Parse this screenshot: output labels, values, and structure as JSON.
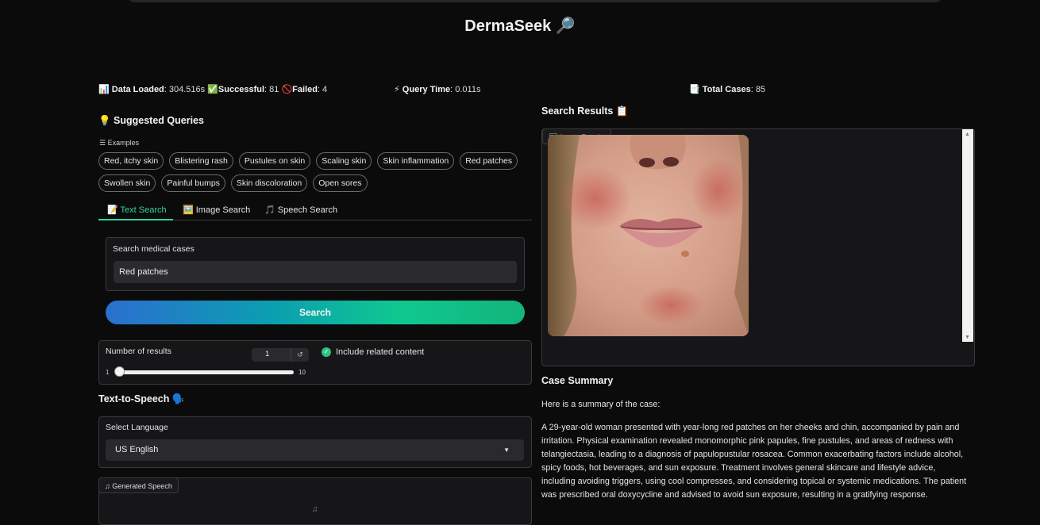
{
  "app": {
    "title": "DermaSeek 🔎"
  },
  "stats": {
    "data_loaded_label": "Data Loaded",
    "data_loaded_value": ": 304.516s",
    "successful_label": "Successful",
    "successful_value": ": 81",
    "failed_label": "Failed",
    "failed_value": ": 4",
    "query_time_label": "Query Time",
    "query_time_value": ": 0.011s",
    "total_cases_label": "Total Cases",
    "total_cases_value": ": 85"
  },
  "suggested": {
    "title": "💡 Suggested Queries",
    "examples_label": "Examples",
    "row1": [
      "Red, itchy skin",
      "Blistering rash",
      "Pustules on skin",
      "Scaling skin",
      "Skin inflammation",
      "Red patches"
    ],
    "row2": [
      "Swollen skin",
      "Painful bumps",
      "Skin discoloration",
      "Open sores"
    ]
  },
  "tabs": {
    "text": "📝 Text Search",
    "image": "🖼️ Image Search",
    "speech": "🎵 Speech Search"
  },
  "search": {
    "label": "Search medical cases",
    "value": "Red patches",
    "button": "Search"
  },
  "results_count": {
    "label": "Number of results",
    "value": "1",
    "min": "1",
    "max": "10",
    "reset": "↺",
    "level": 0.0
  },
  "related": {
    "label": "Include related content",
    "checked": true
  },
  "tts": {
    "title": "Text-to-Speech 🗣️",
    "language_label": "Select Language",
    "language_value": "US English",
    "generated_label": "Generated Speech"
  },
  "results": {
    "title": "Search Results 📋",
    "image_label": "Image Results"
  },
  "summary": {
    "title": "Case Summary",
    "intro": "Here is a summary of the case:",
    "body": "A 29-year-old woman presented with year-long red patches on her cheeks and chin, accompanied by pain and irritation. Physical examination revealed monomorphic pink papules, fine pustules, and areas of redness with telangiectasia, leading to a diagnosis of papulopustular rosacea. Common exacerbating factors include alcohol, spicy foods, hot beverages, and sun exposure. Treatment involves general skincare and lifestyle advice, including avoiding triggers, using cool compresses, and considering topical or systemic medications. The patient was prescribed oral doxycycline and advised to avoid sun exposure, resulting in a gratifying response."
  },
  "colors": {
    "accent": "#2fd49a",
    "background": "#0b0b0b",
    "panel": "#161618"
  }
}
